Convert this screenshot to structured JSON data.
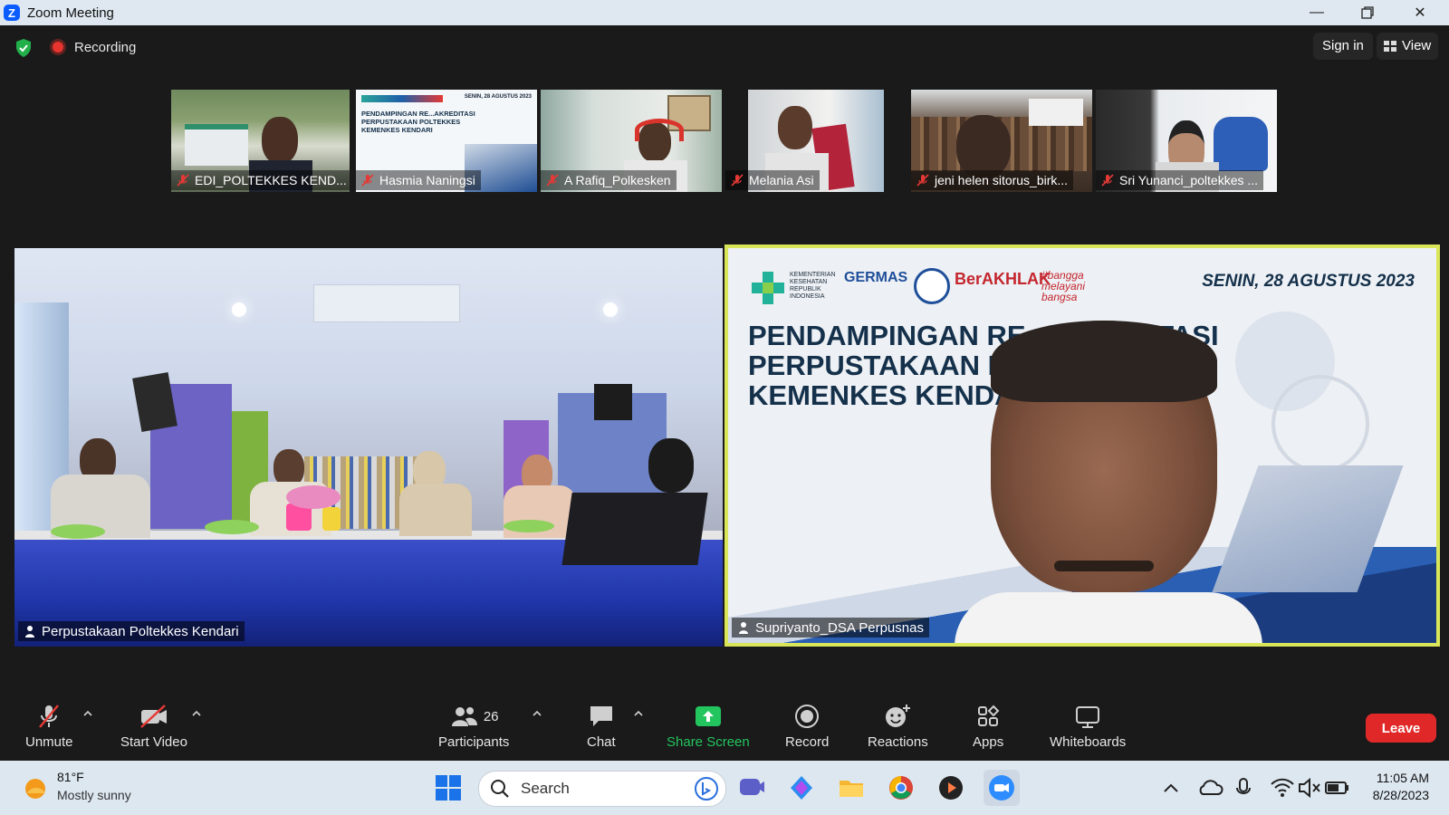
{
  "window": {
    "title": "Zoom Meeting"
  },
  "topbar": {
    "recording_label": "Recording",
    "signin_label": "Sign in",
    "view_label": "View"
  },
  "thumbnails": [
    {
      "name": "EDI_POLTEKKES KEND..."
    },
    {
      "name": "Hasmia Naningsi"
    },
    {
      "name": "A Rafiq_Polkesken"
    },
    {
      "name": "Melania Asi"
    },
    {
      "name": "jeni helen sitorus_birk..."
    },
    {
      "name": "Sri Yunanci_poltekkes ..."
    }
  ],
  "thumb_slide": {
    "date": "SENIN, 28 AGUSTUS 2023",
    "lines": [
      "PENDAMPINGAN RE...AKREDITASI",
      "PERPUSTAKAAN POLTEKKES",
      "KEMENKES KENDARI"
    ]
  },
  "main": {
    "left_name": "Perpustakaan Poltekkes Kendari",
    "right_name": "Supriyanto_DSA Perpusnas",
    "slide": {
      "date": "SENIN, 28 AGUSTUS 2023",
      "line1": "PENDAMPINGAN RE...AKREDITASI",
      "line2": "PERPUSTAKAAN POLTEKKES",
      "line3": "KEMENKES KENDARI",
      "logo_kemenkes": "KEMENTERIAN KESEHATAN REPUBLIK INDONESIA",
      "logo_germas": "GERMAS",
      "logo_berakhlak": "BerAKHLAK",
      "logo_bangga": "#bangga melayani bangsa"
    }
  },
  "toolbar": {
    "unmute": "Unmute",
    "start_video": "Start Video",
    "participants": "Participants",
    "participants_count": "26",
    "chat": "Chat",
    "share": "Share Screen",
    "record": "Record",
    "reactions": "Reactions",
    "apps": "Apps",
    "whiteboards": "Whiteboards",
    "leave": "Leave"
  },
  "taskbar": {
    "temp": "81°F",
    "weather": "Mostly sunny",
    "search_placeholder": "Search",
    "time": "11:05 AM",
    "date": "8/28/2023"
  },
  "colors": {
    "active_speaker_border": "#d9e65a",
    "share_green": "#22c55e",
    "leave_red": "#e02828"
  }
}
